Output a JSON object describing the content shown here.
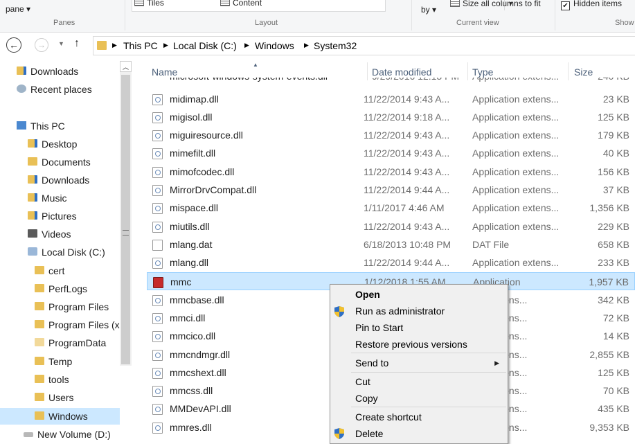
{
  "ribbon": {
    "pane_label": "pane ▾",
    "panes_group": "Panes",
    "tiles": "Tiles",
    "content": "Content",
    "layout_group": "Layout",
    "sort_by": "by ▾",
    "size_all_columns": "Size all columns to fit",
    "current_view_group": "Current view",
    "hidden_items": "Hidden items",
    "hidden_items_checked": true,
    "show_group": "Show"
  },
  "address": {
    "crumbs": [
      "This PC",
      "Local Disk (C:)",
      "Windows",
      "System32"
    ]
  },
  "nav": {
    "items": [
      {
        "label": "Downloads",
        "icon": "downloads-icon"
      },
      {
        "label": "Recent places",
        "icon": "recent-places-icon"
      },
      {
        "label": "This PC",
        "icon": "computer-icon"
      },
      {
        "label": "Desktop",
        "icon": "desktop-folder-icon"
      },
      {
        "label": "Documents",
        "icon": "documents-folder-icon"
      },
      {
        "label": "Downloads",
        "icon": "downloads-folder-icon"
      },
      {
        "label": "Music",
        "icon": "music-folder-icon"
      },
      {
        "label": "Pictures",
        "icon": "pictures-folder-icon"
      },
      {
        "label": "Videos",
        "icon": "videos-folder-icon"
      },
      {
        "label": "Local Disk (C:)",
        "icon": "drive-icon"
      },
      {
        "label": "cert",
        "icon": "folder-icon"
      },
      {
        "label": "PerfLogs",
        "icon": "folder-icon"
      },
      {
        "label": "Program Files",
        "icon": "folder-icon"
      },
      {
        "label": "Program Files (x",
        "icon": "folder-icon"
      },
      {
        "label": "ProgramData",
        "icon": "folder-icon"
      },
      {
        "label": "Temp",
        "icon": "folder-icon"
      },
      {
        "label": "tools",
        "icon": "folder-icon"
      },
      {
        "label": "Users",
        "icon": "folder-icon"
      },
      {
        "label": "Windows",
        "icon": "folder-icon"
      },
      {
        "label": "New Volume (D:)",
        "icon": "drive-icon"
      }
    ],
    "selected": "Windows"
  },
  "columns": {
    "name": "Name",
    "date": "Date modified",
    "type": "Type",
    "size": "Size"
  },
  "files": [
    {
      "name": "midimap.dll",
      "date": "11/22/2014 9:43 A...",
      "type": "Application extens...",
      "size": "23 KB",
      "kind": "dll"
    },
    {
      "name": "migisol.dll",
      "date": "11/22/2014 9:18 A...",
      "type": "Application extens...",
      "size": "125 KB",
      "kind": "dll"
    },
    {
      "name": "miguiresource.dll",
      "date": "11/22/2014 9:43 A...",
      "type": "Application extens...",
      "size": "179 KB",
      "kind": "dll"
    },
    {
      "name": "mimefilt.dll",
      "date": "11/22/2014 9:43 A...",
      "type": "Application extens...",
      "size": "40 KB",
      "kind": "dll"
    },
    {
      "name": "mimofcodec.dll",
      "date": "11/22/2014 9:43 A...",
      "type": "Application extens...",
      "size": "156 KB",
      "kind": "dll"
    },
    {
      "name": "MirrorDrvCompat.dll",
      "date": "11/22/2014 9:44 A...",
      "type": "Application extens...",
      "size": "37 KB",
      "kind": "dll"
    },
    {
      "name": "mispace.dll",
      "date": "1/11/2017 4:46 AM",
      "type": "Application extens...",
      "size": "1,356 KB",
      "kind": "dll"
    },
    {
      "name": "miutils.dll",
      "date": "11/22/2014 9:43 A...",
      "type": "Application extens...",
      "size": "229 KB",
      "kind": "dll"
    },
    {
      "name": "mlang.dat",
      "date": "6/18/2013 10:48 PM",
      "type": "DAT File",
      "size": "658 KB",
      "kind": "dat"
    },
    {
      "name": "mlang.dll",
      "date": "11/22/2014 9:44 A...",
      "type": "Application extens...",
      "size": "233 KB",
      "kind": "dll"
    },
    {
      "name": "mmc",
      "date": "1/12/2018 1:55 AM",
      "type": "Application",
      "size": "1,957 KB",
      "kind": "app"
    },
    {
      "name": "mmcbase.dll",
      "date": "",
      "type": "tion extens...",
      "size": "342 KB",
      "kind": "dll"
    },
    {
      "name": "mmci.dll",
      "date": "",
      "type": "tion extens...",
      "size": "72 KB",
      "kind": "dll"
    },
    {
      "name": "mmcico.dll",
      "date": "",
      "type": "tion extens...",
      "size": "14 KB",
      "kind": "dll"
    },
    {
      "name": "mmcndmgr.dll",
      "date": "",
      "type": "tion extens...",
      "size": "2,855 KB",
      "kind": "dll"
    },
    {
      "name": "mmcshext.dll",
      "date": "",
      "type": "tion extens...",
      "size": "125 KB",
      "kind": "dll"
    },
    {
      "name": "mmcss.dll",
      "date": "",
      "type": "tion extens...",
      "size": "70 KB",
      "kind": "dll"
    },
    {
      "name": "MMDevAPI.dll",
      "date": "",
      "type": "tion extens...",
      "size": "435 KB",
      "kind": "dll"
    },
    {
      "name": "mmres.dll",
      "date": "",
      "type": "tion extens...",
      "size": "9,353 KB",
      "kind": "dll"
    }
  ],
  "context_menu": {
    "open": "Open",
    "run_as_admin": "Run as administrator",
    "pin_to_start": "Pin to Start",
    "restore_previous": "Restore previous versions",
    "send_to": "Send to",
    "cut": "Cut",
    "copy": "Copy",
    "create_shortcut": "Create shortcut",
    "delete": "Delete"
  },
  "colors": {
    "selection": "#cce8ff",
    "accent": "#2f6fc4",
    "folder": "#e9c056"
  }
}
